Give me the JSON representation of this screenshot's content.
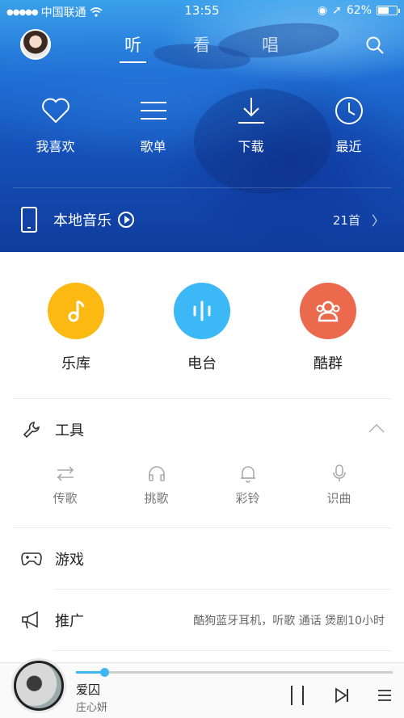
{
  "status_bar": {
    "carrier": "中国联通",
    "time": "13:55",
    "battery": "62%",
    "battery_level": 0.62
  },
  "top_nav": {
    "tabs": [
      {
        "label": "听",
        "active": true
      },
      {
        "label": "看",
        "active": false
      },
      {
        "label": "唱",
        "active": false
      }
    ]
  },
  "quick_actions": [
    {
      "label": "我喜欢",
      "icon": "heart-icon"
    },
    {
      "label": "歌单",
      "icon": "list-icon"
    },
    {
      "label": "下载",
      "icon": "download-icon"
    },
    {
      "label": "最近",
      "icon": "clock-icon"
    }
  ],
  "local_music": {
    "label": "本地音乐",
    "count": "21首"
  },
  "features": [
    {
      "label": "乐库",
      "icon": "music-note-icon",
      "color": "#FCB912"
    },
    {
      "label": "电台",
      "icon": "radio-wave-icon",
      "color": "#3BB8F5"
    },
    {
      "label": "酷群",
      "icon": "group-icon",
      "color": "#EB6A4E"
    }
  ],
  "tools": {
    "label": "工具",
    "items": [
      {
        "label": "传歌",
        "icon": "transfer-icon"
      },
      {
        "label": "挑歌",
        "icon": "headphones-icon"
      },
      {
        "label": "彩铃",
        "icon": "bell-icon"
      },
      {
        "label": "识曲",
        "icon": "mic-icon"
      }
    ]
  },
  "games": {
    "label": "游戏"
  },
  "promo": {
    "label": "推广",
    "text": "酷狗蓝牙耳机，听歌 通话 煲剧10小时"
  },
  "player": {
    "song": "爱囚",
    "artist": "庄心妍",
    "progress": 0.09,
    "accent": "#3EB6F2"
  }
}
